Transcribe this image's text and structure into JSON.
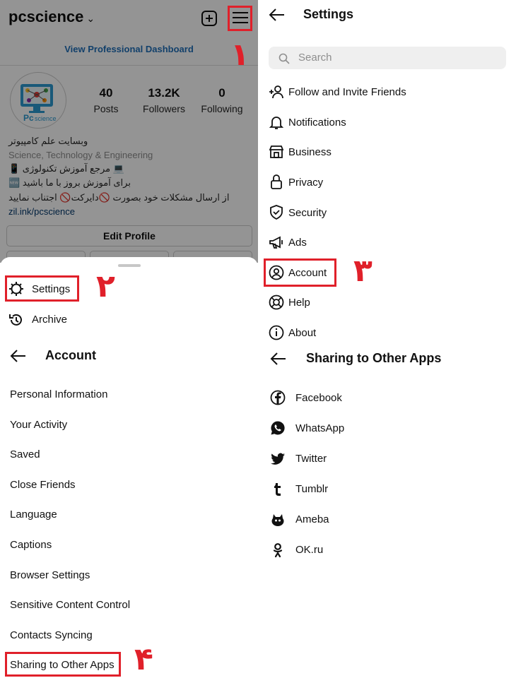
{
  "profile": {
    "username": "pcscience",
    "dashboard_link": "View Professional Dashboard",
    "stats": [
      {
        "value": "40",
        "label": "Posts"
      },
      {
        "value": "13.2K",
        "label": "Followers"
      },
      {
        "value": "0",
        "label": "Following"
      }
    ],
    "bio": {
      "name": "وبسایت علم کامپیوتر",
      "category": "Science, Technology & Engineering",
      "line1": "💻 مرجع آموزش تکنولوژی 📱",
      "line2": "🆕 برای آموزش بروز با ما باشید",
      "line3": "از ارسال مشکلات خود بصورت 🚫دایرکت🚫 اجتناب نمایید",
      "link": "zil.ink/pcscience"
    },
    "edit_profile": "Edit Profile"
  },
  "sheet": {
    "settings": "Settings",
    "archive": "Archive"
  },
  "account": {
    "title": "Account",
    "items": [
      "Personal Information",
      "Your Activity",
      "Saved",
      "Close Friends",
      "Language",
      "Captions",
      "Browser Settings",
      "Sensitive Content Control",
      "Contacts Syncing",
      "Sharing to Other Apps"
    ]
  },
  "settings": {
    "title": "Settings",
    "search_placeholder": "Search",
    "items": [
      {
        "label": "Follow and Invite Friends",
        "icon": "add-person-icon"
      },
      {
        "label": "Notifications",
        "icon": "bell-icon"
      },
      {
        "label": "Business",
        "icon": "store-icon"
      },
      {
        "label": "Privacy",
        "icon": "lock-icon"
      },
      {
        "label": "Security",
        "icon": "shield-icon"
      },
      {
        "label": "Ads",
        "icon": "megaphone-icon"
      },
      {
        "label": "Account",
        "icon": "user-circle-icon"
      },
      {
        "label": "Help",
        "icon": "lifebuoy-icon"
      },
      {
        "label": "About",
        "icon": "info-icon"
      }
    ]
  },
  "sharing": {
    "title": "Sharing to Other Apps",
    "items": [
      {
        "label": "Facebook",
        "icon": "facebook-icon"
      },
      {
        "label": "WhatsApp",
        "icon": "whatsapp-icon"
      },
      {
        "label": "Twitter",
        "icon": "twitter-icon"
      },
      {
        "label": "Tumblr",
        "icon": "tumblr-icon"
      },
      {
        "label": "Ameba",
        "icon": "ameba-icon"
      },
      {
        "label": "OK.ru",
        "icon": "okru-icon"
      }
    ]
  },
  "annotations": {
    "step1": "۱",
    "step2": "۲",
    "step3": "۳",
    "step4": "۴",
    "color": "#e0202a"
  }
}
